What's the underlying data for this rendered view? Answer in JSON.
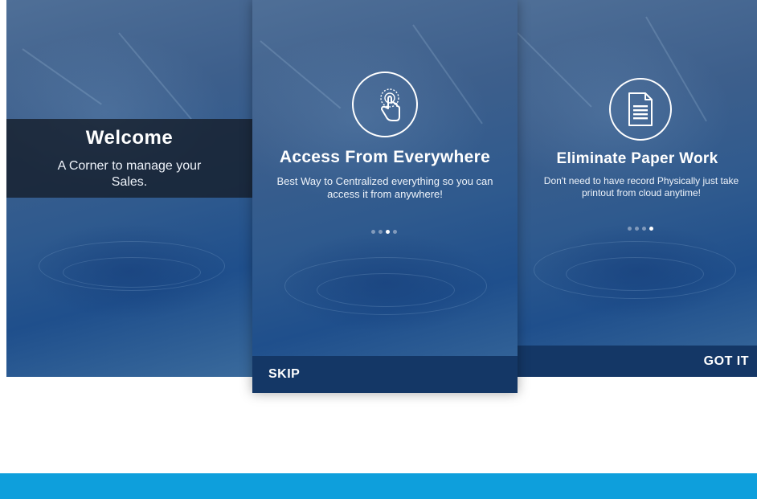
{
  "screens": {
    "welcome": {
      "title": "Welcome",
      "subtitle": "A Corner to manage your Sales."
    },
    "access": {
      "icon": "touch-hand-icon",
      "title": "Access From Everywhere",
      "description": "Best Way to Centralized everything so you can access it from anywhere!",
      "page_indicator": {
        "count": 4,
        "active": 3
      },
      "skip_label": "SKIP"
    },
    "paperless": {
      "icon": "document-icon",
      "title": "Eliminate Paper Work",
      "description": "Don't need to have record Physically just take printout from cloud anytime!",
      "page_indicator": {
        "count": 4,
        "active": 4
      },
      "got_it_label": "GOT IT"
    }
  },
  "colors": {
    "footer_bar": "#143766",
    "accent_strip": "#0e9fdc",
    "welcome_band": "#141c28"
  }
}
